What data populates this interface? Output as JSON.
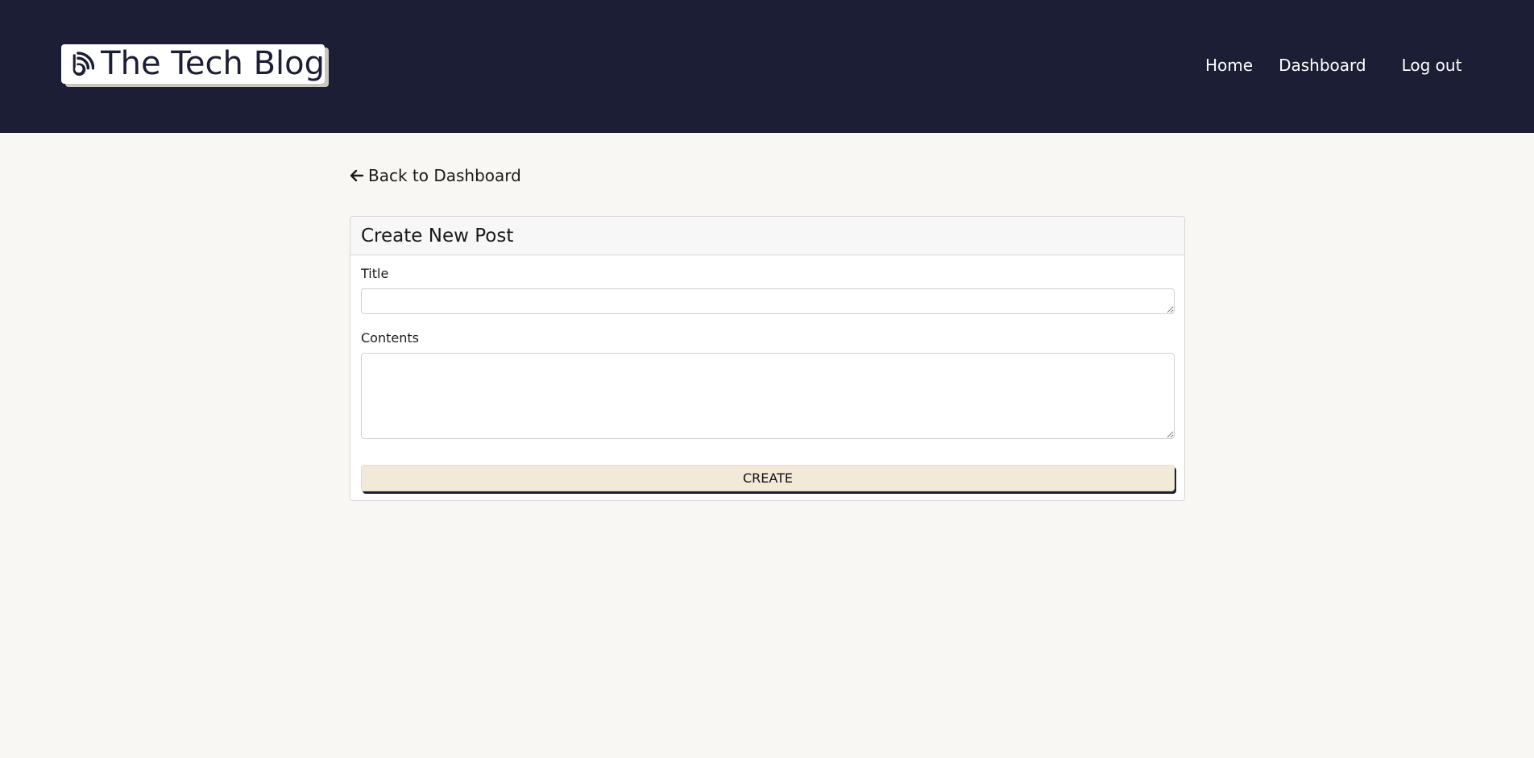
{
  "header": {
    "brand": "The Tech Blog",
    "logo_icon": "blog-icon",
    "background_color": "#1c1e35",
    "nav": {
      "home": "Home",
      "dashboard": "Dashboard",
      "logout": "Log out"
    }
  },
  "back_link": {
    "label": "Back to Dashboard",
    "icon": "arrow-left-icon"
  },
  "form": {
    "title": "Create New Post",
    "title_label": "Title",
    "title_value": "",
    "contents_label": "Contents",
    "contents_value": "",
    "submit_label": "CREATE",
    "submit_color": "#f2e9d8"
  },
  "page_background": "#f8f7f3"
}
